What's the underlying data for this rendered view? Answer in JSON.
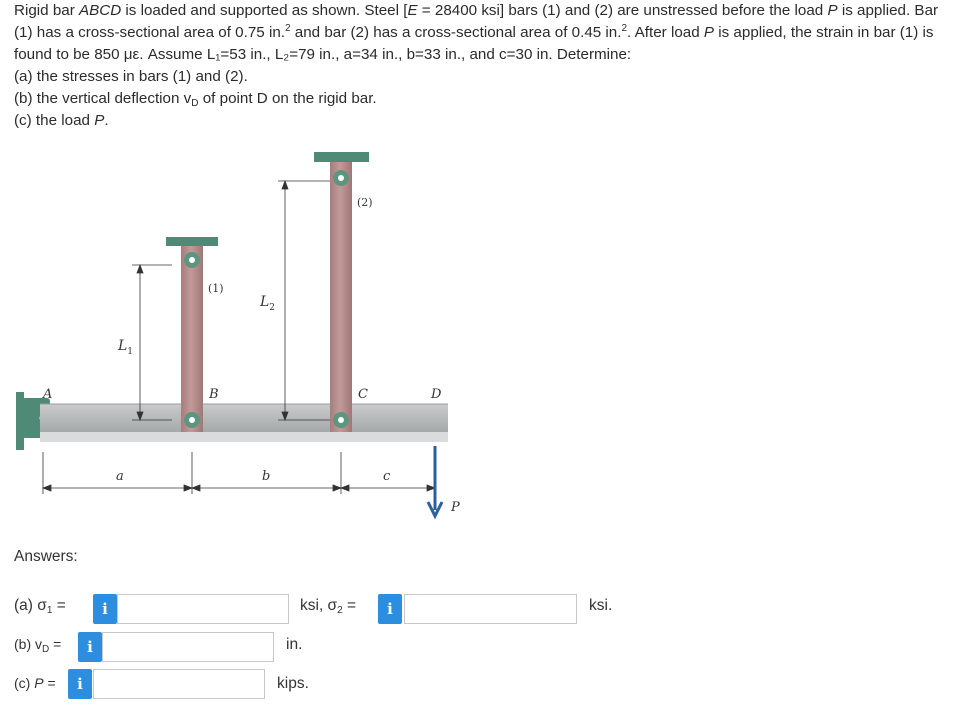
{
  "problem": {
    "line1_a": "Rigid bar ",
    "line1_abcd": "ABCD",
    "line1_b": " is loaded and supported as shown. Steel [",
    "line1_E": "E",
    "line1_c": " = 28400 ksi] bars (1) and (2) are unstressed before the load ",
    "line1_P": "P",
    "line1_d": " is applied. Bar",
    "line2_a": "(1) has a cross-sectional area of 0.75 in.",
    "line2_sup1": "2",
    "line2_b": " and bar (2) has a cross-sectional area of 0.45 in.",
    "line2_sup2": "2",
    "line2_c": ". After load ",
    "line2_P": "P",
    "line2_d": " is applied, the strain in bar (1) is",
    "line3": "found to be 850 με. Assume L₁=53 in., L₂=79 in., a=34 in., b=33 in., and c=30 in. Determine:",
    "part_a": "(a) the stresses in bars (1) and (2).",
    "part_b_a": "(b) the vertical deflection v",
    "part_b_sub": "D",
    "part_b_b": " of point D on the rigid bar.",
    "part_c_a": "(c) the load ",
    "part_c_P": "P",
    "part_c_b": "."
  },
  "figure": {
    "labels": {
      "A": "A",
      "B": "B",
      "C": "C",
      "D": "D",
      "P": "P",
      "bar1": "(1)",
      "bar2": "(2)",
      "L1": "L",
      "L1_sub": "1",
      "L2": "L",
      "L2_sub": "2",
      "a": "a",
      "b": "b",
      "c": "c"
    },
    "colors": {
      "rigid_bar": "#b9bcbd",
      "rigid_bar_edge": "#9a9d9e",
      "deformable_bar": "#b58b8b",
      "support": "#4f8a76",
      "pin": "#ffffff"
    }
  },
  "answers": {
    "heading": "Answers:",
    "a": {
      "label": "(a) σ",
      "label_sub": "1",
      "eq": " =",
      "value": "",
      "unit_mid": "ksi, σ",
      "unit_mid_sub": "2",
      "unit_mid_eq": " =",
      "value2": "",
      "unit": "ksi."
    },
    "b": {
      "label": "(b) v",
      "label_sub": "D",
      "eq": " =",
      "value": "",
      "unit": "in."
    },
    "c": {
      "label": "(c) ",
      "label_P": "P",
      "eq": " =",
      "value": "",
      "unit": "kips."
    },
    "info_icon": "i"
  }
}
